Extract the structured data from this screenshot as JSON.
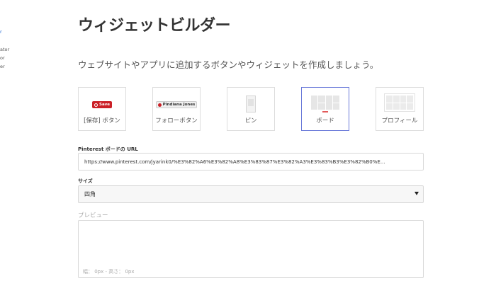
{
  "sidebar": {
    "items": [
      {
        "label": "r",
        "active": true
      },
      {
        "label": "ator",
        "active": false
      },
      {
        "label": "or",
        "active": false
      },
      {
        "label": "er",
        "active": false
      }
    ]
  },
  "page": {
    "title": "ウィジェットビルダー",
    "subtitle": "ウェブサイトやアプリに追加するボタンやウィジェットを作成しましょう。"
  },
  "widgets": [
    {
      "label": "[保存] ボタン",
      "preview_text": "Save",
      "selected": false
    },
    {
      "label": "フォローボタン",
      "preview_text": "Pindiana Jones",
      "selected": false
    },
    {
      "label": "ピン",
      "selected": false
    },
    {
      "label": "ボード",
      "selected": true
    },
    {
      "label": "プロフィール",
      "selected": false
    }
  ],
  "form": {
    "url_label": "Pinterest ボードの URL",
    "url_value": "https://www.pinterest.com/jyarink0/%E3%82%A6%E3%82%A8%E3%83%87%E3%82%A3%E3%83%B3%E3%82%B0%E...",
    "size_label": "サイズ",
    "size_value": "四角",
    "preview_label": "プレビュー",
    "preview_dimensions": "幅： 0px - 高さ： 0px"
  },
  "colors": {
    "accent_blue": "#2b6fd6",
    "pinterest_red": "#cb2027",
    "selected_border": "#6a7ad9"
  }
}
